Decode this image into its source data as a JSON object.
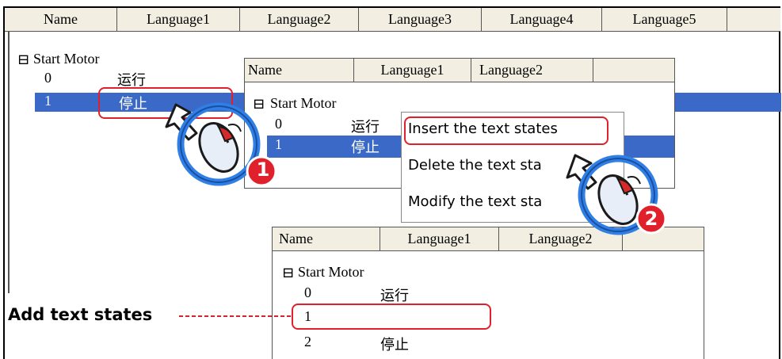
{
  "main": {
    "columns": [
      "Name",
      "Language1",
      "Language2",
      "Language3",
      "Language4",
      "Language5"
    ],
    "group": "Start Motor",
    "expand_glyph": "⊟",
    "rows": [
      {
        "value": "0",
        "text": "运行"
      },
      {
        "value": "1",
        "text": "停止"
      }
    ]
  },
  "popup1": {
    "columns": [
      "Name",
      "Language1",
      "Language2"
    ],
    "group": "Start Motor",
    "rows": [
      {
        "value": "0",
        "text": "运行"
      },
      {
        "value": "1",
        "text": "停止"
      }
    ]
  },
  "context_menu": {
    "items": [
      "Insert the text states",
      "Delete the text sta",
      "Modify the text sta"
    ]
  },
  "popup2": {
    "columns": [
      "Name",
      "Language1",
      "Language2"
    ],
    "group": "Start Motor",
    "rows": [
      {
        "value": "0",
        "text": "运行"
      },
      {
        "value": "1",
        "text": ""
      },
      {
        "value": "2",
        "text": "停止"
      }
    ]
  },
  "annotation": {
    "label": "Add text states",
    "step1": "1",
    "step2": "2"
  },
  "colors": {
    "selection": "#3a69c8",
    "highlight_red": "#e0202a",
    "header_bg": "#f2efe2",
    "mouse_blue": "#2f7fe6"
  }
}
